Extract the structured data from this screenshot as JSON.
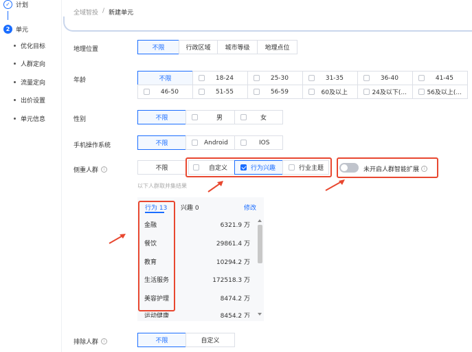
{
  "sidebar": {
    "step1": {
      "label": "计划"
    },
    "step2": {
      "num": "2",
      "label": "单元"
    },
    "subs": [
      "优化目标",
      "人群定向",
      "流量定向",
      "出价设置",
      "单元信息"
    ]
  },
  "breadcrumb": {
    "parent": "全域智投",
    "sep": "/",
    "current": "新建单元"
  },
  "geo": {
    "label": "地理位置",
    "options": [
      "不限",
      "行政区域",
      "城市等级",
      "地理点位"
    ]
  },
  "age": {
    "label": "年龄",
    "options": [
      "不限",
      "18-24",
      "25-30",
      "31-35",
      "36-40",
      "41-45",
      "46-50",
      "51-55",
      "56-59",
      "60及以上",
      "24及以下(...",
      "56及以上(..."
    ]
  },
  "gender": {
    "label": "性别",
    "options": [
      "不限",
      "男",
      "女"
    ]
  },
  "os": {
    "label": "手机操作系统",
    "options": [
      "不限",
      "Android",
      "IOS"
    ]
  },
  "crowd": {
    "label": "侧重人群",
    "info_icon": "info-icon",
    "options": [
      "不限",
      "自定义",
      "行为兴趣",
      "行业主题"
    ],
    "hint": "以下人群取并集结果",
    "toggle_label": "未开启人群智能扩展"
  },
  "panel": {
    "tab_active": "行为 13",
    "tab_other": "兴趣 0",
    "edit": "修改",
    "rows": [
      {
        "name": "金融",
        "value": "6321.9 万"
      },
      {
        "name": "餐饮",
        "value": "29861.4 万"
      },
      {
        "name": "教育",
        "value": "10294.2 万"
      },
      {
        "name": "生活服务",
        "value": "172518.3 万"
      },
      {
        "name": "美容护理",
        "value": "8474.2 万"
      },
      {
        "name": "运动健康",
        "value": "8454.2 万"
      }
    ]
  },
  "exclude": {
    "label": "排除人群",
    "options": [
      "不限",
      "自定义"
    ]
  },
  "colors": {
    "accent": "#1a6dff",
    "highlight": "#e8472f"
  }
}
